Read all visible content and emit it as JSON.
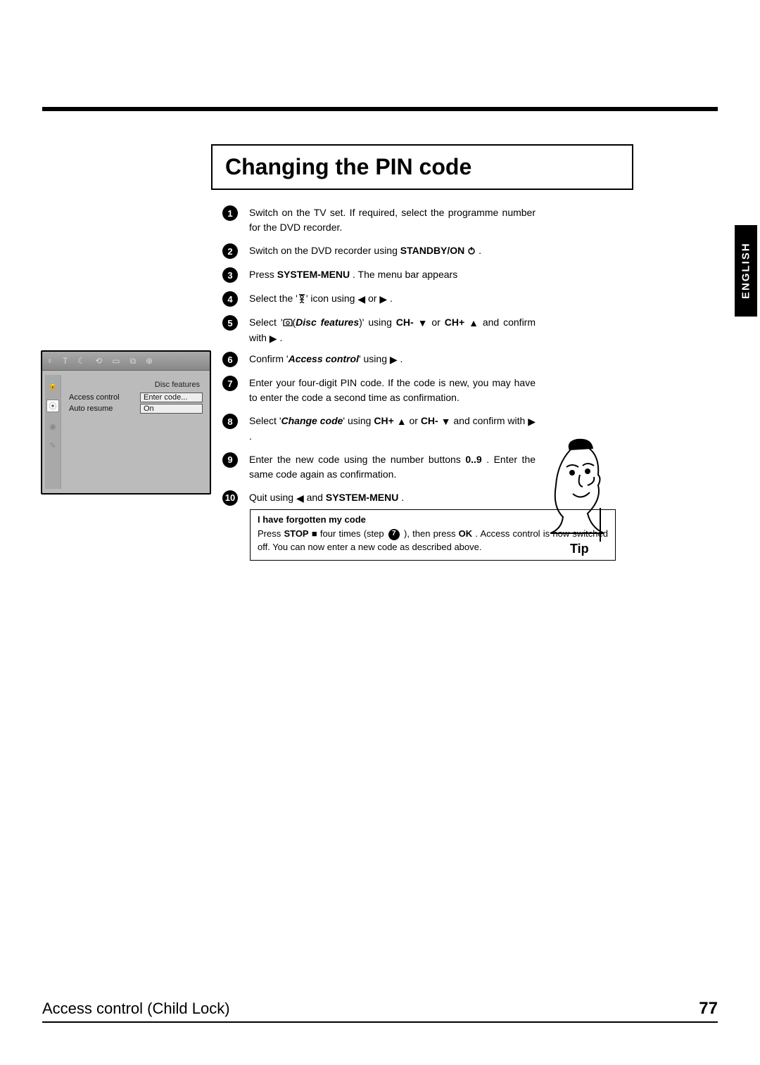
{
  "lang_tab": "ENGLISH",
  "section_title": "Changing the PIN code",
  "steps": [
    {
      "n": "1",
      "parts": [
        {
          "t": "Switch on the TV set. If required, select the programme number for the DVD recorder."
        }
      ]
    },
    {
      "n": "2",
      "parts": [
        {
          "t": "Switch on the DVD recorder using "
        },
        {
          "t": "STANDBY/ON",
          "b": true
        },
        {
          "t": " "
        },
        {
          "icon": "power"
        },
        {
          "t": " ."
        }
      ]
    },
    {
      "n": "3",
      "parts": [
        {
          "t": "Press "
        },
        {
          "t": "SYSTEM-MENU",
          "b": true
        },
        {
          "t": " . The menu bar appears"
        }
      ]
    },
    {
      "n": "4",
      "parts": [
        {
          "t": "Select the '"
        },
        {
          "icon": "person"
        },
        {
          "t": "' icon using "
        },
        {
          "icon": "left"
        },
        {
          "t": " or "
        },
        {
          "icon": "right"
        },
        {
          "t": " ."
        }
      ]
    },
    {
      "n": "5",
      "parts": [
        {
          "t": "Select '"
        },
        {
          "icon": "disc"
        },
        {
          "t": "("
        },
        {
          "t": "Disc features",
          "bi": true
        },
        {
          "t": ")' using "
        },
        {
          "t": "CH-",
          "b": true
        },
        {
          "t": " "
        },
        {
          "icon": "down"
        },
        {
          "t": " or "
        },
        {
          "t": "CH+",
          "b": true
        },
        {
          "t": " "
        },
        {
          "icon": "up"
        },
        {
          "t": " and confirm with "
        },
        {
          "icon": "right"
        },
        {
          "t": " ."
        }
      ]
    }
  ],
  "steps2": [
    {
      "n": "6",
      "parts": [
        {
          "t": "Confirm '"
        },
        {
          "t": "Access control",
          "bi": true
        },
        {
          "t": "' using "
        },
        {
          "icon": "right"
        },
        {
          "t": " ."
        }
      ]
    },
    {
      "n": "7",
      "parts": [
        {
          "t": "Enter your four-digit PIN code. If the code is new, you may have to enter the code a second time as confirmation."
        }
      ]
    },
    {
      "n": "8",
      "parts": [
        {
          "t": "Select '"
        },
        {
          "t": "Change code",
          "bi": true
        },
        {
          "t": "' using "
        },
        {
          "t": "CH+",
          "b": true
        },
        {
          "t": " "
        },
        {
          "icon": "up"
        },
        {
          "t": " or "
        },
        {
          "t": "CH-",
          "b": true
        },
        {
          "t": " "
        },
        {
          "icon": "down"
        },
        {
          "t": " and confirm with "
        },
        {
          "icon": "right"
        },
        {
          "t": " ."
        }
      ]
    },
    {
      "n": "9",
      "parts": [
        {
          "t": "Enter the new code using the number buttons "
        },
        {
          "t": "0..9",
          "b": true
        },
        {
          "t": " . Enter the same code again as confirmation."
        }
      ]
    },
    {
      "n": "10",
      "parts": [
        {
          "t": "Quit using "
        },
        {
          "icon": "left"
        },
        {
          "t": " and "
        },
        {
          "t": "SYSTEM-MENU",
          "b": true
        },
        {
          "t": " ."
        }
      ]
    }
  ],
  "tip": {
    "title": "I have forgotten my code",
    "pre": "Press ",
    "stop": "STOP",
    "square": true,
    "mid1": " four times (step ",
    "ref": "7",
    "mid2": " ), then press ",
    "ok": "OK",
    "tail": " . Access control is now switched off. You can now enter a new code as described above.",
    "label": "Tip"
  },
  "osd": {
    "heading": "Disc features",
    "rows": [
      {
        "label": "Access control",
        "value": "Enter code..."
      },
      {
        "label": "Auto resume",
        "value": "On"
      }
    ]
  },
  "footer": {
    "title": "Access control (Child Lock)",
    "page": "77"
  }
}
